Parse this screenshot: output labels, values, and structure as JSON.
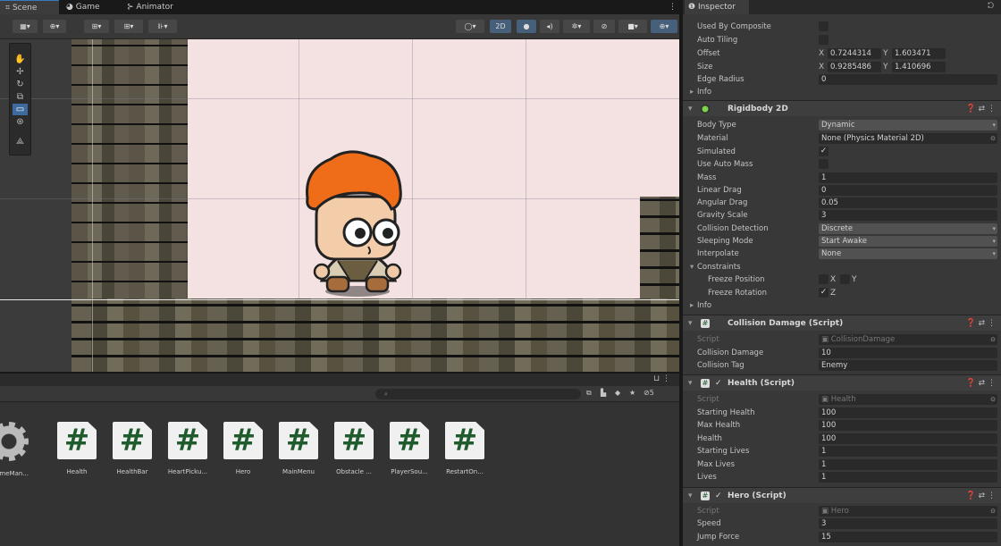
{
  "tabs": {
    "scene": "Scene",
    "game": "Game",
    "animator": "Animator"
  },
  "toolbar": {
    "mode_2d": "2D"
  },
  "project": {
    "search_placeholder": "",
    "hidden_count": "5",
    "assets": [
      {
        "name": "ameMan..."
      },
      {
        "name": "Health"
      },
      {
        "name": "HealthBar"
      },
      {
        "name": "HeartPicku..."
      },
      {
        "name": "Hero"
      },
      {
        "name": "MainMenu"
      },
      {
        "name": "Obstacle ..."
      },
      {
        "name": "PlayerSou..."
      },
      {
        "name": "RestartOn..."
      }
    ],
    "hash_glyph": "#"
  },
  "inspector": {
    "title": "Inspector",
    "collider": {
      "used_by_composite": "Used By Composite",
      "auto_tiling": "Auto Tiling",
      "offset_label": "Offset",
      "offset_x": "0.7244314",
      "offset_y": "1.603471",
      "size_label": "Size",
      "size_x": "0.9285486",
      "size_y": "1.410696",
      "edge_radius_label": "Edge Radius",
      "edge_radius": "0",
      "info": "Info"
    },
    "rigidbody": {
      "title": "Rigidbody 2D",
      "body_type_label": "Body Type",
      "body_type": "Dynamic",
      "material_label": "Material",
      "material": "None (Physics Material 2D)",
      "simulated_label": "Simulated",
      "auto_mass_label": "Use Auto Mass",
      "mass_label": "Mass",
      "mass": "1",
      "linear_drag_label": "Linear Drag",
      "linear_drag": "0",
      "angular_drag_label": "Angular Drag",
      "angular_drag": "0.05",
      "gravity_label": "Gravity Scale",
      "gravity": "3",
      "collision_label": "Collision Detection",
      "collision": "Discrete",
      "sleeping_label": "Sleeping Mode",
      "sleeping": "Start Awake",
      "interpolate_label": "Interpolate",
      "interpolate": "None",
      "constraints_label": "Constraints",
      "freeze_pos_label": "Freeze Position",
      "freeze_rot_label": "Freeze Rotation",
      "info": "Info"
    },
    "collision_damage": {
      "title": "Collision Damage (Script)",
      "script_label": "Script",
      "script": "CollisionDamage",
      "damage_label": "Collision Damage",
      "damage": "10",
      "tag_label": "Collision Tag",
      "tag": "Enemy"
    },
    "health": {
      "title": "Health (Script)",
      "script_label": "Script",
      "script": "Health",
      "starting_health_label": "Starting Health",
      "starting_health": "100",
      "max_health_label": "Max Health",
      "max_health": "100",
      "health_label": "Health",
      "health": "100",
      "starting_lives_label": "Starting Lives",
      "starting_lives": "1",
      "max_lives_label": "Max Lives",
      "max_lives": "1",
      "lives_label": "Lives",
      "lives": "1"
    },
    "hero": {
      "title": "Hero (Script)",
      "script_label": "Script",
      "script": "Hero",
      "speed_label": "Speed",
      "speed": "3",
      "jump_label": "Jump Force",
      "jump": "15"
    }
  },
  "colors": {
    "accent": "#3a79bb",
    "selected": "#46607c",
    "script_green": "#1f5b2d"
  }
}
